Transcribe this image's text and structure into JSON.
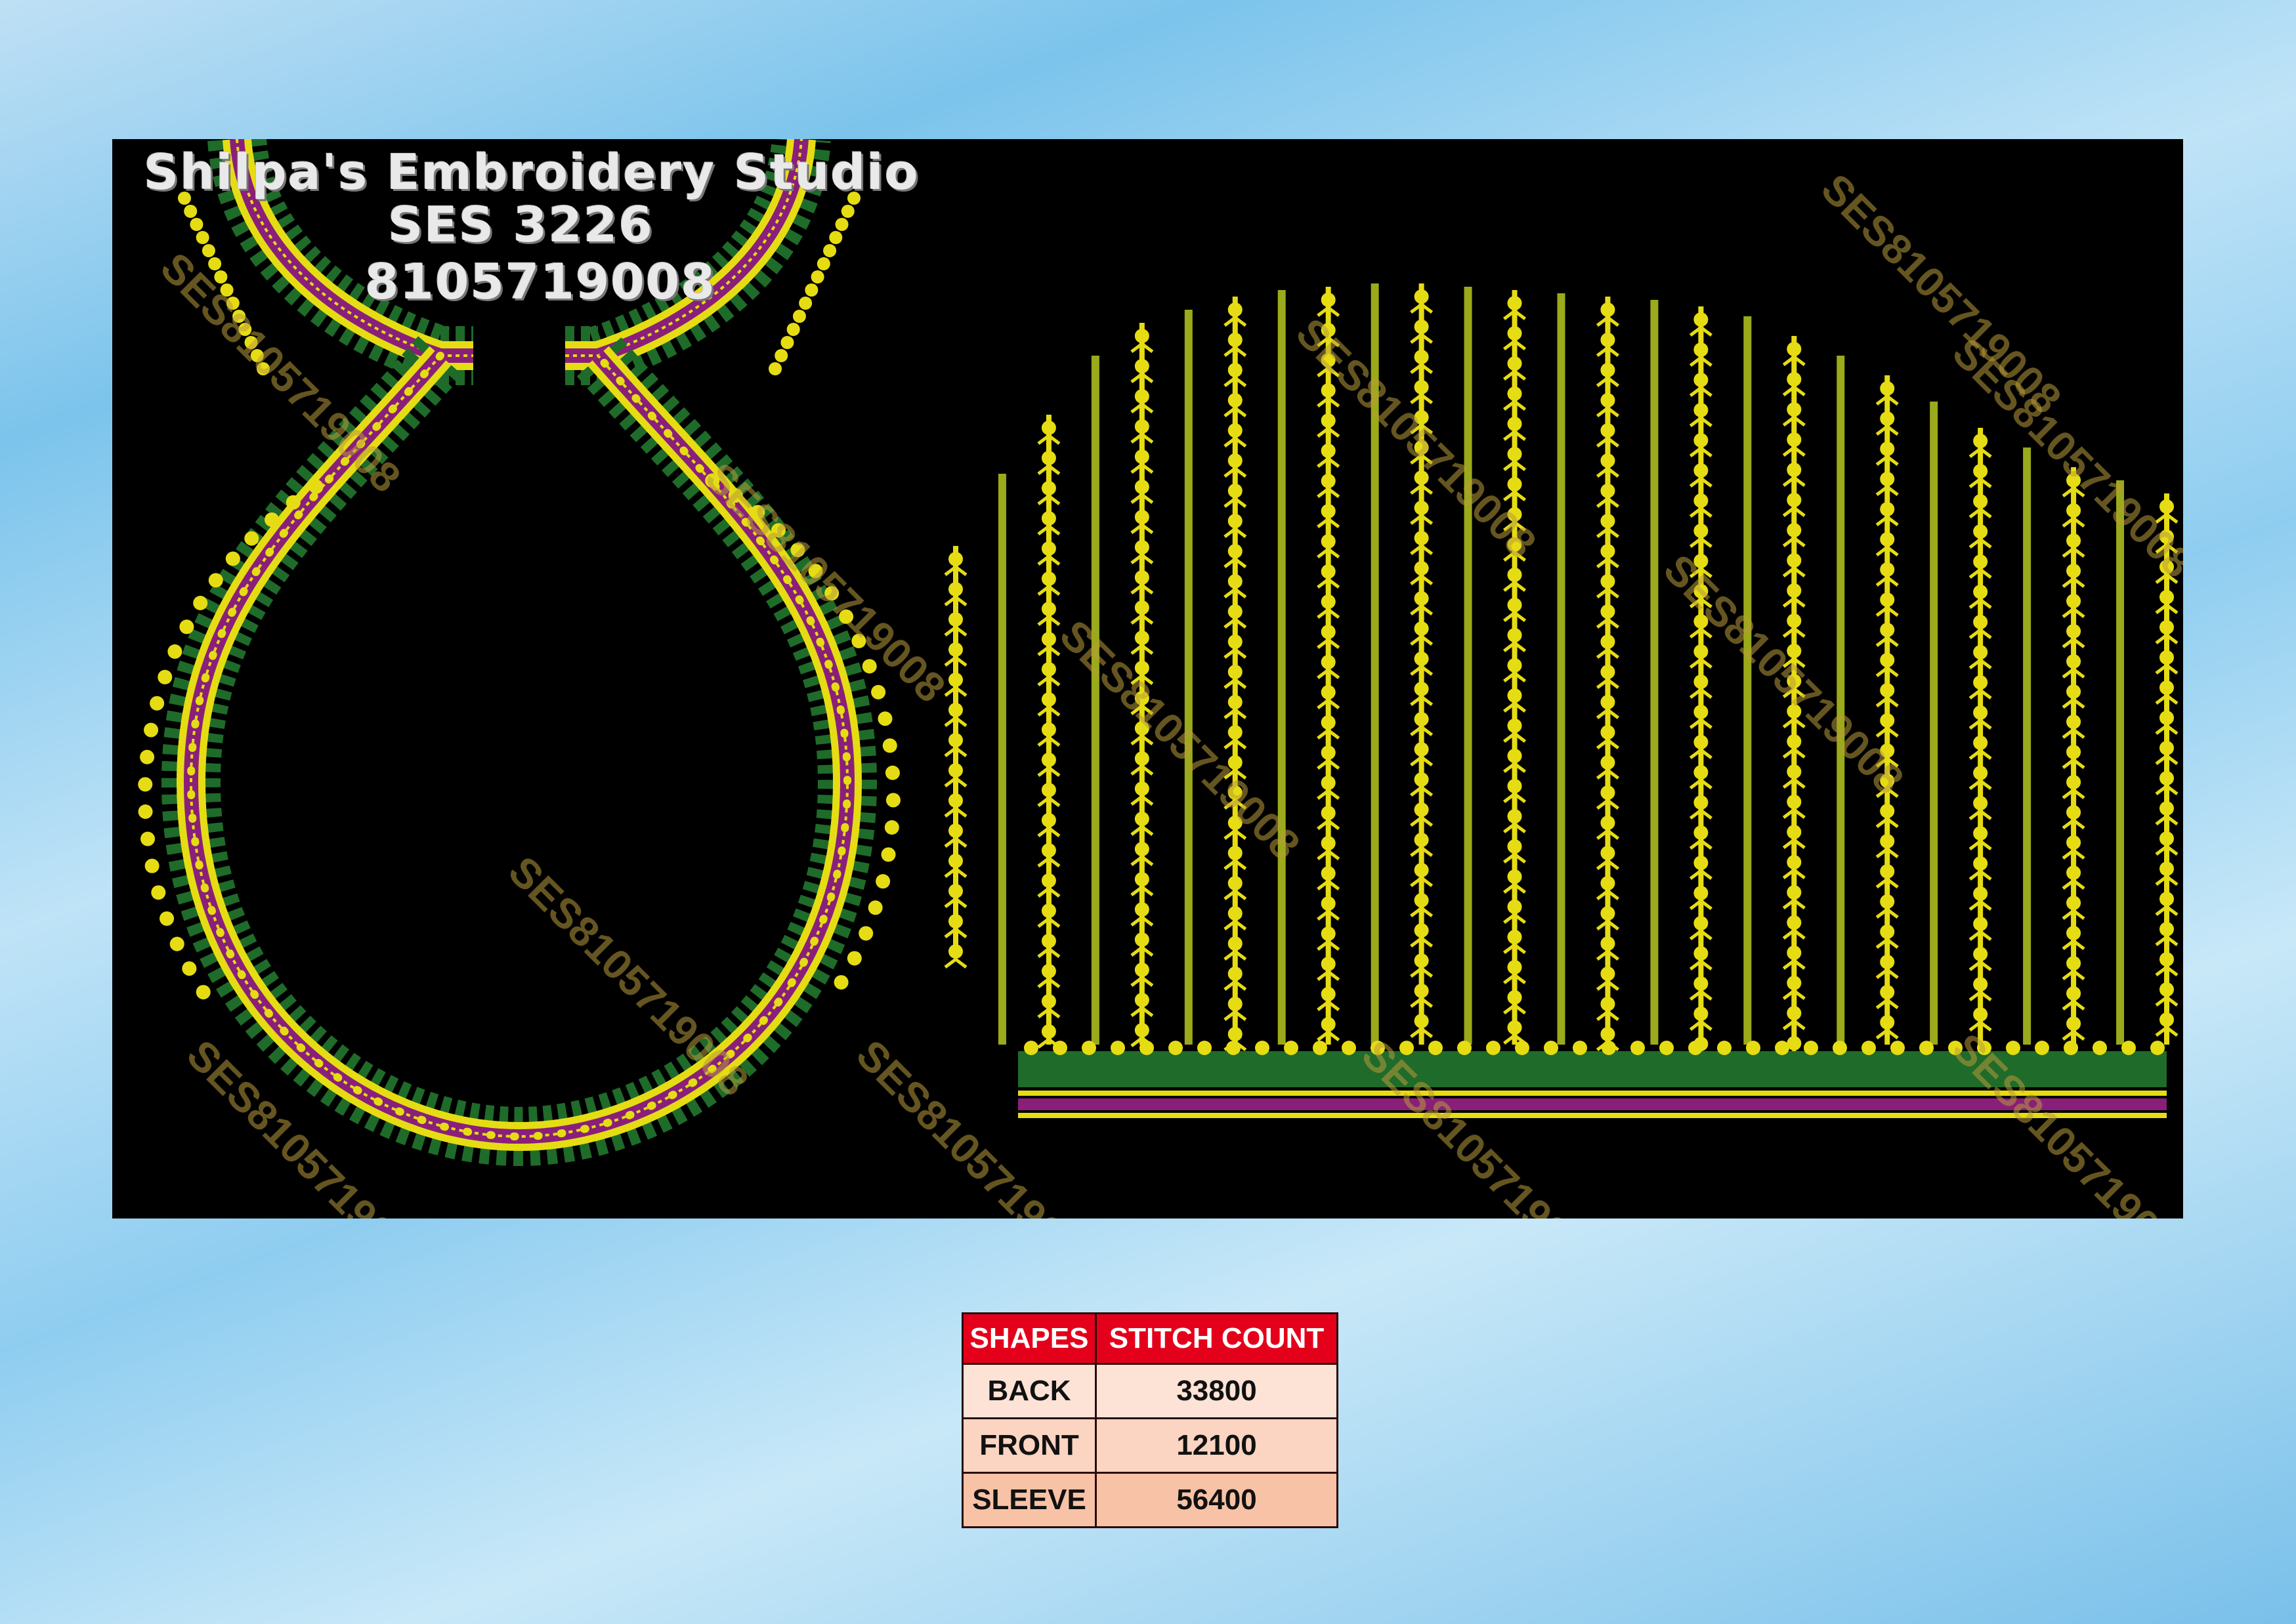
{
  "studio": {
    "name": "Shilpa's Embroidery Studio",
    "code": "SES 3226",
    "phone": "8105719008"
  },
  "watermark": "SES8105719008",
  "colors": {
    "background": "#000000",
    "gold": "#e6dc14",
    "olive": "#9aaa1a",
    "green": "#1f6b2a",
    "purple": "#8a1f7a",
    "table_header": "#e4001b"
  },
  "table": {
    "headers": [
      "SHAPES",
      "STITCH COUNT"
    ],
    "rows": [
      {
        "shape": "BACK",
        "count": "33800"
      },
      {
        "shape": "FRONT",
        "count": "12100"
      },
      {
        "shape": "SLEEVE",
        "count": "56400"
      }
    ]
  }
}
